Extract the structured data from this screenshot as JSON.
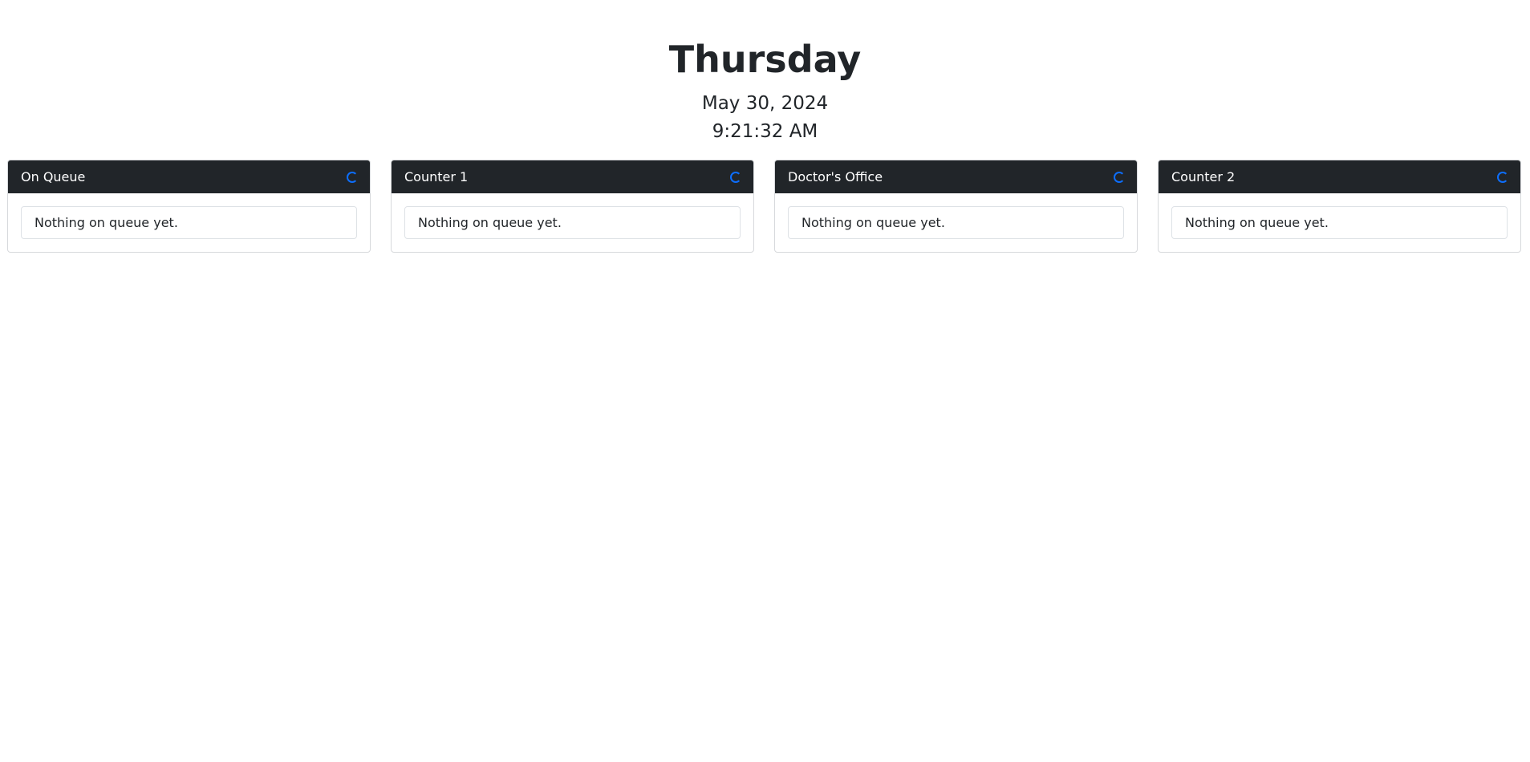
{
  "header": {
    "day": "Thursday",
    "date": "May 30, 2024",
    "time": "9:21:32 AM"
  },
  "panels": [
    {
      "title": "On Queue",
      "empty_text": "Nothing on queue yet.",
      "icon": "loading-spinner-icon"
    },
    {
      "title": "Counter 1",
      "empty_text": "Nothing on queue yet.",
      "icon": "loading-spinner-icon"
    },
    {
      "title": "Doctor's Office",
      "empty_text": "Nothing on queue yet.",
      "icon": "loading-spinner-icon"
    },
    {
      "title": "Counter 2",
      "empty_text": "Nothing on queue yet.",
      "icon": "loading-spinner-icon"
    }
  ],
  "colors": {
    "header_bg": "#212529",
    "spinner": "#0d6efd",
    "text": "#212529"
  }
}
